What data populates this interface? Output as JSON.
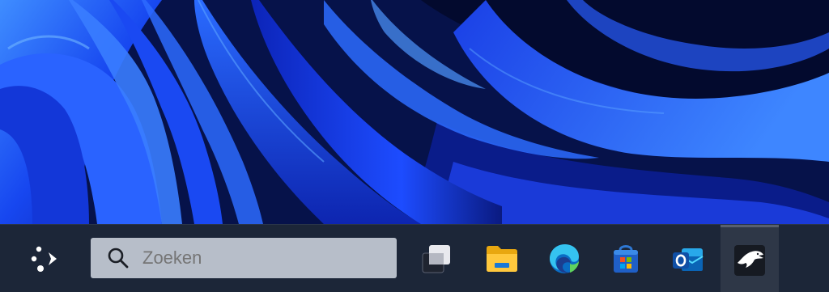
{
  "desktop": {
    "wallpaper": "windows-11-bloom-blue",
    "colors": {
      "deep": "#05113a",
      "mid": "#1030d8",
      "bright": "#2a6bff",
      "highlight": "#4fa0ff"
    }
  },
  "taskbar": {
    "background": "#1c2638",
    "start": {
      "icon": "start-dots-icon"
    },
    "search": {
      "icon": "search-icon",
      "placeholder": "Zoeken"
    },
    "apps": [
      {
        "id": "task-view",
        "icon": "task-view-icon"
      },
      {
        "id": "file-explorer",
        "icon": "folder-icon"
      },
      {
        "id": "edge",
        "icon": "edge-icon"
      },
      {
        "id": "microsoft-store",
        "icon": "store-icon"
      },
      {
        "id": "outlook",
        "icon": "outlook-icon"
      },
      {
        "id": "eagle-app",
        "icon": "eagle-icon",
        "active": true
      }
    ]
  }
}
